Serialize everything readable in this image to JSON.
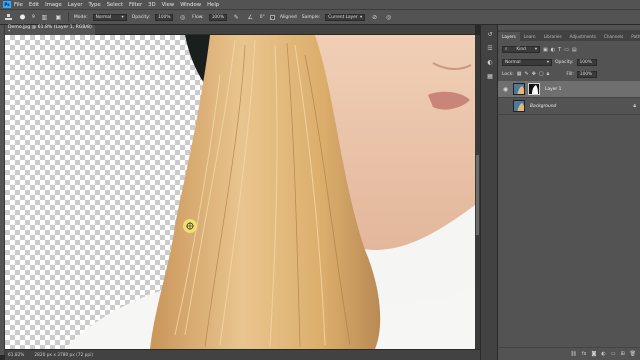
{
  "menu": {
    "logo": "Ps",
    "items": [
      "File",
      "Edit",
      "Image",
      "Layer",
      "Type",
      "Select",
      "Filter",
      "3D",
      "View",
      "Window",
      "Help"
    ]
  },
  "options": {
    "brush_size": "9",
    "mode_label": "Mode:",
    "mode_value": "Normal",
    "opacity_label": "Opacity:",
    "opacity_value": "100%",
    "flow_label": "Flow:",
    "flow_value": "100%",
    "angle_value": "0°",
    "aligned_label": "Aligned",
    "sample_label": "Sample:",
    "sample_value": "Current Layer"
  },
  "document": {
    "tab_title": "Demo.jpg @ 61.8% (Layer 1, RGB/8) *"
  },
  "status": {
    "zoom": "61.82%",
    "dimensions": "2820 px x 3780 px (72 ppi)"
  },
  "panel": {
    "tabs": [
      "Layers",
      "Learn",
      "Libraries",
      "Adjustments",
      "Channels",
      "Paths"
    ],
    "kind_label": "Kind",
    "blend_mode": "Normal",
    "opacity_label": "Opacity:",
    "opacity_value": "100%",
    "lock_label": "Lock:",
    "fill_label": "Fill:",
    "fill_value": "100%",
    "layers": [
      {
        "name": "Layer 1",
        "selected": true
      },
      {
        "name": "Background",
        "selected": false
      }
    ]
  },
  "colors": {
    "accent": "#31a8ff",
    "hair": "#e2b878",
    "skin": "#e8c4a8"
  }
}
